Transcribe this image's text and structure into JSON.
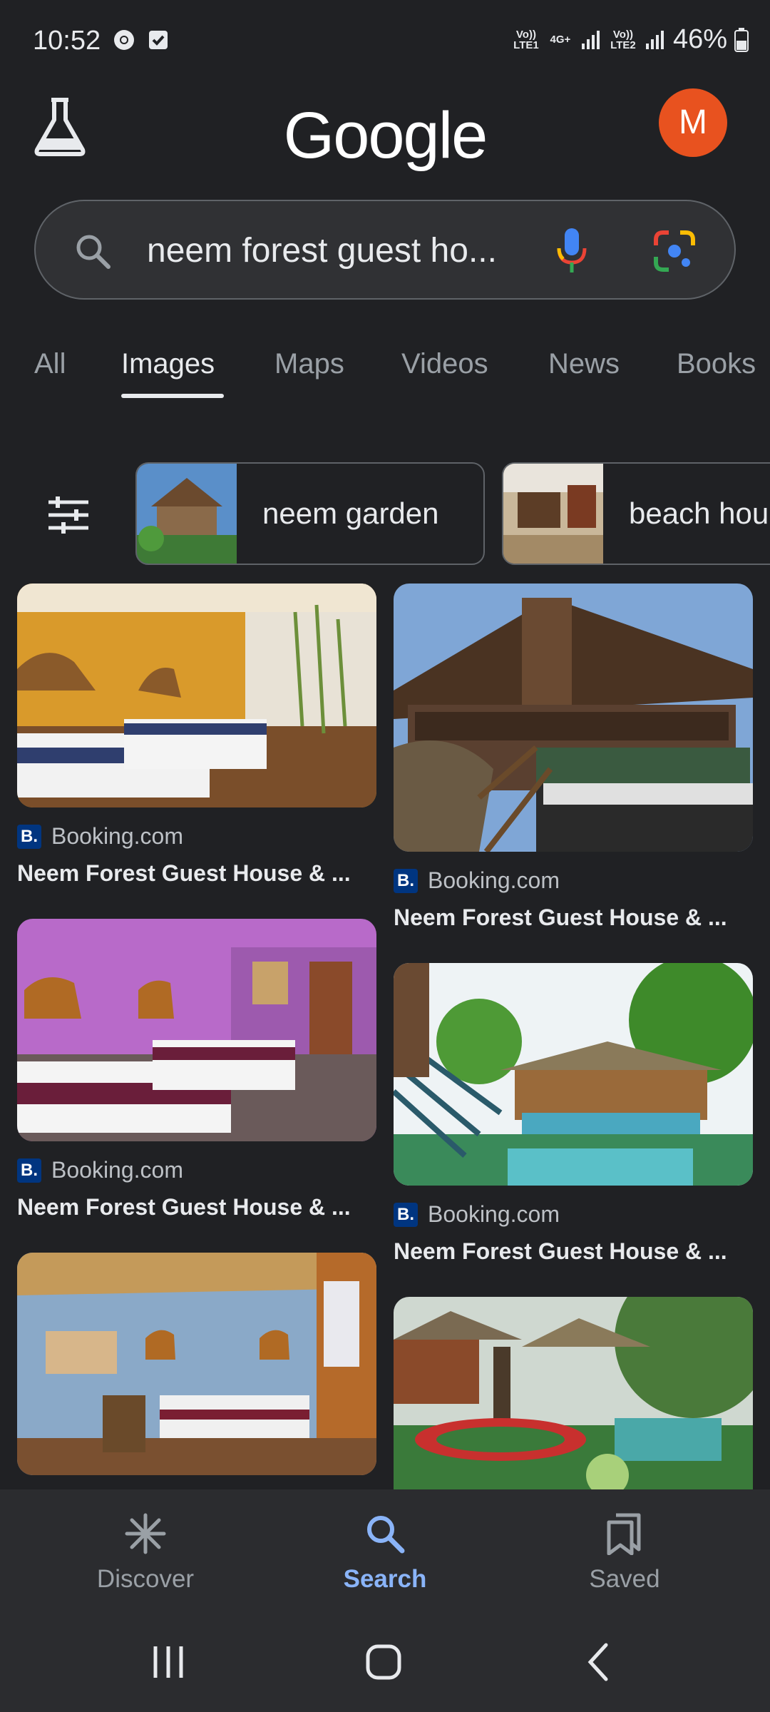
{
  "status_bar": {
    "time": "10:52",
    "sim1": "Vo)) LTE1",
    "net": "4G+",
    "sim2": "Vo)) LTE2",
    "battery": "46%"
  },
  "header": {
    "logo": "Google",
    "avatar_letter": "M"
  },
  "search": {
    "query": "neem forest guest ho..."
  },
  "tabs": [
    {
      "label": "All"
    },
    {
      "label": "Images"
    },
    {
      "label": "Maps"
    },
    {
      "label": "Videos"
    },
    {
      "label": "News"
    },
    {
      "label": "Books"
    }
  ],
  "active_tab": "Images",
  "chips": [
    {
      "label": "neem garden"
    },
    {
      "label": "beach hou"
    }
  ],
  "results": [
    {
      "source": "Booking.com",
      "badge": "B.",
      "title": "Neem Forest Guest House & ..."
    },
    {
      "source": "Booking.com",
      "badge": "B.",
      "title": "Neem Forest Guest House & ..."
    },
    {
      "source": "Booking.com",
      "badge": "B.",
      "title": "Neem Forest Guest House & ..."
    },
    {
      "source": "Booking.com",
      "badge": "B.",
      "title": "Neem Forest Guest House & ..."
    }
  ],
  "bottom_nav": [
    {
      "label": "Discover",
      "icon": "asterisk-icon"
    },
    {
      "label": "Search",
      "icon": "search-icon"
    },
    {
      "label": "Saved",
      "icon": "bookmarks-icon"
    }
  ],
  "active_nav": "Search",
  "colors": {
    "accent": "#8ab4f8",
    "background": "#202124",
    "avatar": "#e8521f",
    "booking": "#003580"
  }
}
